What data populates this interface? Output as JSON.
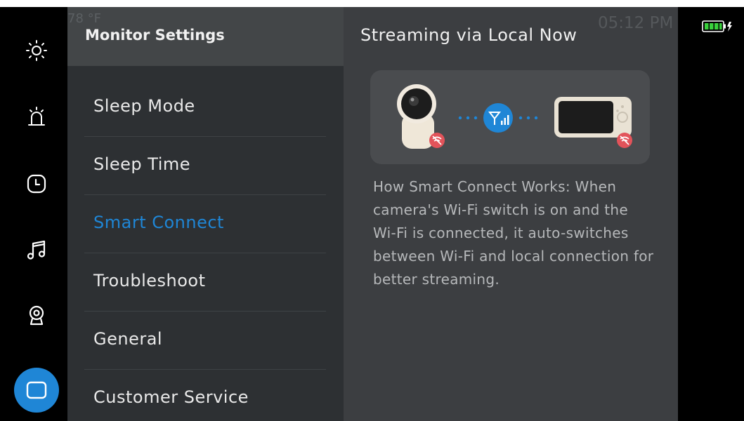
{
  "status_bar": {
    "ghost_left": "78 °F",
    "ghost_time": "05:12 PM",
    "battery_icon": "battery-charging-icon",
    "battery_color": "#39d13c"
  },
  "rail": {
    "items": [
      {
        "name": "brightness",
        "icon": "sun-icon"
      },
      {
        "name": "alarm",
        "icon": "alarm-icon"
      },
      {
        "name": "timer",
        "icon": "clock-icon"
      },
      {
        "name": "music",
        "icon": "music-note-icon"
      },
      {
        "name": "camera",
        "icon": "camera-icon"
      },
      {
        "name": "monitor",
        "icon": "monitor-icon",
        "active": true
      }
    ],
    "accent": "#1f86d6"
  },
  "menu": {
    "title": "Monitor Settings",
    "items": [
      {
        "label": "Sleep Mode"
      },
      {
        "label": "Sleep Time"
      },
      {
        "label": "Smart Connect",
        "selected": true
      },
      {
        "label": "Troubleshoot"
      },
      {
        "label": "General"
      },
      {
        "label": "Customer Service"
      }
    ]
  },
  "detail": {
    "title": "Streaming via Local Now",
    "description": "How Smart Connect Works: When camera's Wi-Fi switch is on and the Wi-Fi is connected, it auto-switches between Wi-Fi and local connection for better streaming."
  }
}
